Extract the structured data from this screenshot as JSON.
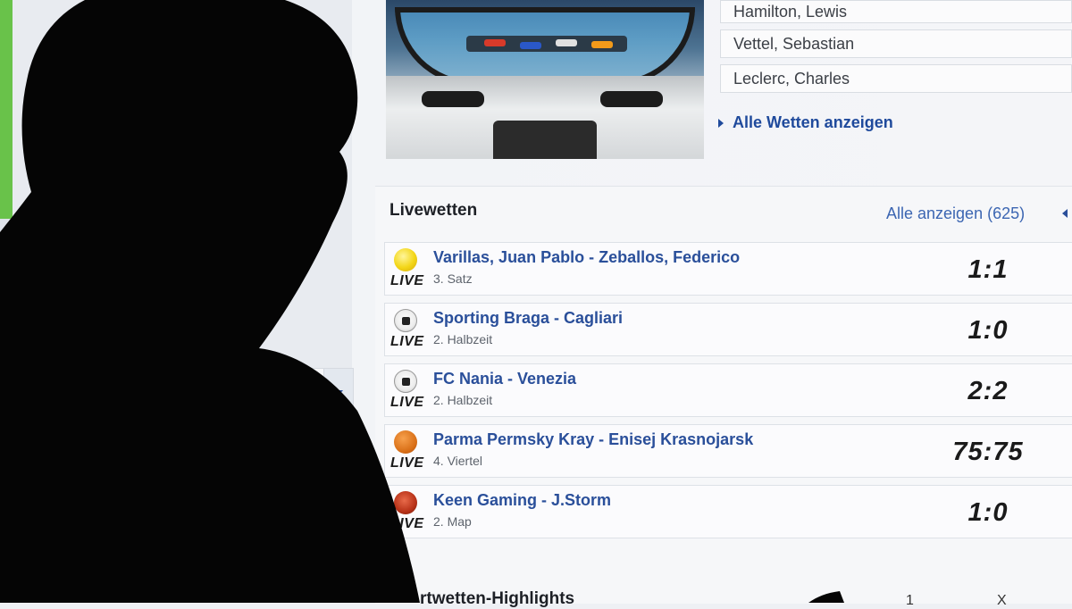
{
  "featured": {
    "drivers": [
      "Hamilton, Lewis",
      "Vettel, Sebastian",
      "Leclerc, Charles"
    ],
    "all_bets_link": "Alle Wetten anzeigen"
  },
  "livebets": {
    "title": "Livewetten",
    "show_all_link": "Alle anzeigen (625)",
    "matches": [
      {
        "sport_icon": "tennis-ball-icon",
        "live_label": "LIVE",
        "teams": "Varillas, Juan Pablo - Zeballos, Federico",
        "period": "3. Satz",
        "score": "1:1"
      },
      {
        "sport_icon": "soccer-ball-icon",
        "live_label": "LIVE",
        "teams": "Sporting Braga - Cagliari",
        "period": "2. Halbzeit",
        "score": "1:0"
      },
      {
        "sport_icon": "soccer-ball-icon",
        "live_label": "LIVE",
        "teams": "FC Nania - Venezia",
        "period": "2. Halbzeit",
        "score": "2:2"
      },
      {
        "sport_icon": "basketball-icon",
        "live_label": "LIVE",
        "teams": "Parma Permsky Kray - Enisej Krasnojarsk",
        "period": "4. Viertel",
        "score": "75:75"
      },
      {
        "sport_icon": "esports-icon",
        "live_label": "LIVE",
        "teams": "Keen Gaming - J.Storm",
        "period": "2. Map",
        "score": "1:0"
      }
    ]
  },
  "highlights": {
    "title_partial": "rtwetten-Highlights",
    "col_1": "1",
    "col_x": "X"
  },
  "colors": {
    "link_blue": "#2a4f9a",
    "accent_green": "#69c24a"
  }
}
